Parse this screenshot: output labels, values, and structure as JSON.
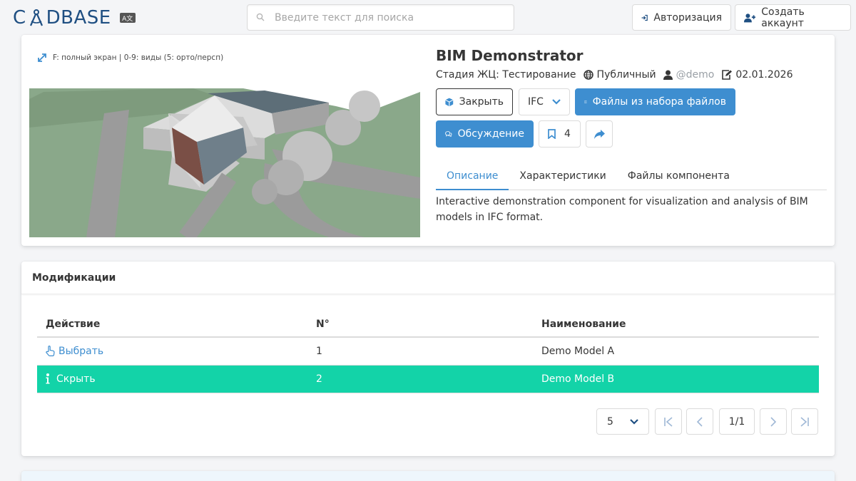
{
  "header": {
    "logo_text_left": "C",
    "logo_text_right": "DBASE",
    "lang_label": "A文",
    "search_placeholder": "Введите текст для поиска",
    "login_label": "Авторизация",
    "signup_label": "Создать аккаунт"
  },
  "viewer": {
    "hint": "F: полный экран | 0-9: виды (5: орто/персп)"
  },
  "component": {
    "title": "BIM Demonstrator",
    "stage": "Стадия ЖЦ: Тестирование",
    "visibility": "Публичный",
    "owner": "@demo",
    "date": "02.01.2026",
    "close_label": "Закрыть",
    "format_value": "IFC",
    "files_label": "Файлы из набора файлов",
    "discussion_label": "Обсуждение",
    "bookmark_count": "4",
    "tabs": [
      {
        "label": "Описание",
        "active": true
      },
      {
        "label": "Характеристики",
        "active": false
      },
      {
        "label": "Файлы компонента",
        "active": false
      }
    ],
    "description": "Interactive demonstration component for visualization and analysis of BIM models in IFC format."
  },
  "modifications": {
    "title": "Модификации",
    "columns": [
      "Действие",
      "N°",
      "Наименование"
    ],
    "rows": [
      {
        "action": "Выбрать",
        "number": "1",
        "name": "Demo Model A",
        "selected": false
      },
      {
        "action": "Скрыть",
        "number": "2",
        "name": "Demo Model B",
        "selected": true
      }
    ],
    "page_size": "5",
    "page_indicator": "1/1"
  },
  "colors": {
    "brand": "#1f4f82",
    "info": "#3e8ed0",
    "selected_row": "#13d3a8"
  }
}
